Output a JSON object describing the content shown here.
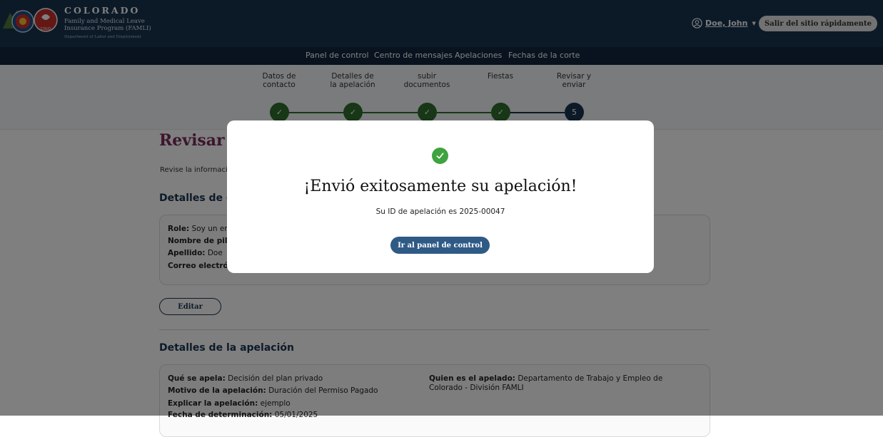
{
  "header": {
    "state_name": "COLORADO",
    "program_line1": "Family and Medical Leave",
    "program_line2": "Insurance Program (FAMLI)",
    "department": "Department of Labor and Employment",
    "logo_badge": "COLO",
    "user_name": "Doe, John",
    "quick_exit_label": "Salir del sitio rápidamente"
  },
  "nav": {
    "items": [
      "Panel de control",
      "Centro de mensajes",
      "Apelaciones",
      "Fechas de la corte"
    ]
  },
  "stepper": {
    "steps": [
      {
        "line1": "Datos de",
        "line2": "contacto",
        "status": "complete"
      },
      {
        "line1": "Detalles de",
        "line2": "la apelación",
        "status": "complete"
      },
      {
        "line1": "subir",
        "line2": "documentos",
        "status": "complete"
      },
      {
        "line1": "Fiestas",
        "line2": "",
        "status": "complete"
      },
      {
        "line1": "Revisar y",
        "line2": "enviar",
        "status": "current",
        "number": "5"
      }
    ]
  },
  "main": {
    "page_title": "Revisar y",
    "intro": "Revise la informació",
    "contact_section_title": "Detalles de co",
    "contact_fields": [
      {
        "label": "Role:",
        "value": "Soy un emp"
      },
      {
        "label": "Nombre de pila:",
        "value": ""
      },
      {
        "label": "Apellido:",
        "value": "Doe"
      },
      {
        "label": "Correo electróni",
        "value": ""
      }
    ],
    "edit_label": "Editar",
    "appeal_section_title": "Detalles de la apelación",
    "appeal_fields_left": [
      {
        "label": "Qué se apela:",
        "value": "Decisión del plan privado"
      },
      {
        "label": "Motivo de la apelación:",
        "value": "Duración del Permiso Pagado"
      },
      {
        "label": "Explicar la apelación:",
        "value": "ejemplo"
      },
      {
        "label": "Fecha de determinación:",
        "value": "05/01/2025"
      }
    ],
    "appeal_fields_right": [
      {
        "label": "Quien es el apelado:",
        "value": "Departamento de Trabajo y Empleo de",
        "value_line2": "Colorado - División FAMLI"
      }
    ]
  },
  "modal": {
    "title": "¡Envió exitosamente su apelación!",
    "subtitle_prefix": "Su ID de apelación es ",
    "appeal_id": "2025-00047",
    "button_label": "Ir al panel de control"
  },
  "colors": {
    "header_bg": "#193450",
    "nav_bg": "#10273f",
    "step_complete": "#2f6e2f",
    "step_current": "#193450",
    "success": "#3fa33f",
    "primary_button": "#2f5a86",
    "title_accent": "#7a2a5a"
  }
}
